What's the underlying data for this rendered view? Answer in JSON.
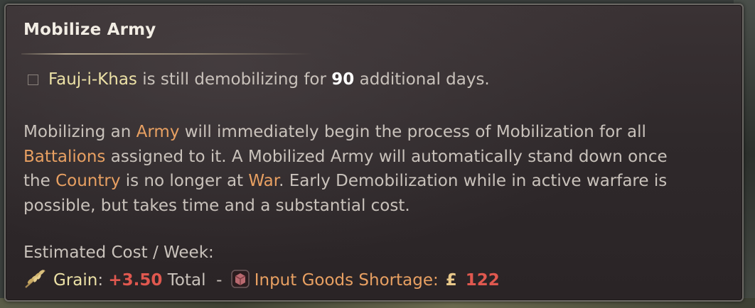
{
  "tooltip": {
    "title": "Mobilize Army",
    "status": {
      "army_name": "Fauj-i-Khas",
      "text_before_days": " is still demobilizing for ",
      "days": "90",
      "text_after_days": " additional days."
    },
    "description": {
      "line1": {
        "t1": "Mobilizing an ",
        "l1": "Army",
        "t2": " will immediately begin the process of Mobilization for all"
      },
      "line2": {
        "l1": "Battalions",
        "t1": " assigned to it. A Mobilized Army will automatically stand down once"
      },
      "line3": {
        "t1": "the ",
        "l1": "Country",
        "t2": " is no longer at ",
        "l2": "War",
        "t3": ". Early Demobilization while in active warfare is"
      },
      "line4": {
        "t1": "possible, but takes time and a substantial cost."
      }
    },
    "cost": {
      "header": "Estimated Cost / Week:",
      "goods_name": "Grain",
      "colon": ":",
      "amount": "+3.50",
      "total_label": " Total  - ",
      "shortage_label": "Input Goods Shortage:",
      "currency_symbol": "£",
      "shortage_value": "122"
    },
    "icons": {
      "checkbox": "empty-checkbox",
      "goods": "wheat-icon",
      "shortage": "input-goods-shortage-icon",
      "currency": "pound-icon"
    },
    "colors": {
      "link": "#e8a062",
      "highlight": "#ece1a6",
      "negative": "#e0584f",
      "body_text": "#c9c2bb"
    }
  }
}
